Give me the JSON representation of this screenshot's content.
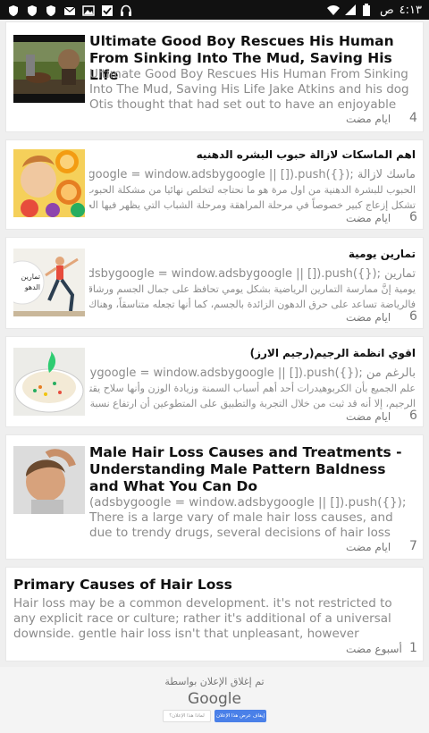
{
  "status_bar": {
    "time": "٤:١٣",
    "ampm": "ص",
    "left_icons": [
      "shield-icon",
      "shield-icon",
      "shield-icon",
      "mail-icon",
      "image-icon",
      "check-box-icon",
      "headset-icon"
    ],
    "right_icons": [
      "battery-icon",
      "signal-icon",
      "wifi-icon"
    ]
  },
  "articles": [
    {
      "title": "Ultimate Good Boy Rescues His Human From Sinking Into The Mud, Saving His Life",
      "snippet": "Ultimate Good Boy Rescues His Human From Sinking Into The Mud, Saving His Life Jake Atkins and his dog Otis thought that had set out to have an enjoyable day of duck",
      "time_num": "4",
      "time_text": "ايام مضت",
      "thumb": "dog-video-thumbnail"
    },
    {
      "title": "اهم الماسكات لازالة حبوب البشره الدهنيه",
      "snippet_lines": [
        "ماسك لازالة ;({})adsbygoogle = window.adsbygoogle || []).push)",
        "الحبوب للبشرة الدهنية من اول مرة هو ما نحتاجه لتخلص نهائيا من مشكلة الحبوب التي",
        "تشكل إزعاج كبير خصوصاً في مرحلة المراهقة ومرحلة الشباب التي يظهر فيها الحبوب"
      ],
      "time_num": "6",
      "time_text": "ايام مضت",
      "thumb": "woman-orange-thumbnail"
    },
    {
      "title": "تمارين يومية",
      "thumb_label": "تمارين الدهو",
      "snippet_lines": [
        "تمارين ;({})adsbygoogle = window.adsbygoogle || []).push)",
        "يومية إنَّ ممارسة التمارين الرياضية بشكل يومي تحافظ على جمال الجسم ورشاقته،",
        "فالرياضة تساعد على حرق الدهون الزائدة بالجسم، كما أنها تجعله متناسقاً، وهناك العديد"
      ],
      "time_num": "6",
      "time_text": "ايام مضت",
      "thumb": "exercise-thumbnail"
    },
    {
      "title": "اقوي انظمة الرجيم(رجيم الارز)",
      "snippet_lines": [
        "بالرغم من ;({})adsbygoogle = window.adsbygoogle || []).push)",
        "علم الجميع بأن الكربوهيدرات أحد أهم أسباب السمنة وزيادة الوزن وأنها سلاح يقتل",
        "الرجيم، إلا أنه قد ثبت من خلال التجربة والتطبيق على المتطوعين أن ارتفاع نسبة"
      ],
      "time_num": "6",
      "time_text": "ايام مضت",
      "thumb": "rice-dish-thumbnail"
    },
    {
      "title": "Male Hair Loss Causes and Treatments - Understanding Male Pattern Baldness and What You Can Do",
      "snippet": "(adsbygoogle = window.adsbygoogle || []).push({}); There is a large vary of male hair loss causes, and due to trendy drugs, several decisions of hair loss treatment for you to",
      "time_num": "7",
      "time_text": "ايام مضت",
      "thumb": "man-hair-thumbnail"
    },
    {
      "title": "Primary Causes of Hair Loss",
      "snippet": "Hair loss may be a common development. it's not restricted to any explicit race or culture; rather it's additional of a universal downside. gentle hair loss isn't that unpleasant, however excessive hair loss could need correct",
      "time_num": "1",
      "time_text": "أسبوع مضت"
    }
  ],
  "ad_footer": {
    "closed_text": "تم إغلاق الإعلان بواسطة",
    "brand": "Google",
    "stop_button": "إيقاف عرض هذا الإعلان",
    "why_button": "لماذا هذا الإعلان؟"
  }
}
